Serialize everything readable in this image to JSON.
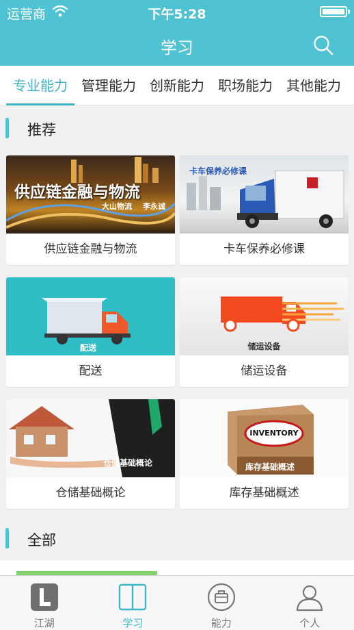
{
  "status": {
    "carrier": "运营商",
    "time": "下午5:28"
  },
  "nav": {
    "title": "学习"
  },
  "tabs": [
    "专业能力",
    "管理能力",
    "创新能力",
    "职场能力",
    "其他能力"
  ],
  "sections": {
    "recommend": "推荐",
    "all": "全部"
  },
  "courses": [
    {
      "label": "供应链金融与物流",
      "thumb_title": "供应链金融与物流",
      "thumb_sub1": "大山物流",
      "thumb_sub2": "李永诚"
    },
    {
      "label": "卡车保养必修课",
      "thumb_title": "卡车保养必修课"
    },
    {
      "label": "配送",
      "thumb_title": "配送"
    },
    {
      "label": "储运设备",
      "thumb_title": "储运设备"
    },
    {
      "label": "仓储基础概论",
      "thumb_title": "仓储基础概论"
    },
    {
      "label": "库存基础概述",
      "thumb_title": "库存基础概述",
      "box_text": "INVENTORY"
    }
  ],
  "tabbar": [
    {
      "label": "江湖",
      "icon": "jianghu-logo-icon"
    },
    {
      "label": "学习",
      "icon": "book-icon"
    },
    {
      "label": "能力",
      "icon": "briefcase-icon"
    },
    {
      "label": "个人",
      "icon": "person-icon"
    }
  ],
  "colors": {
    "accent": "#4fc3d3",
    "active_text": "#3fb4c6"
  }
}
